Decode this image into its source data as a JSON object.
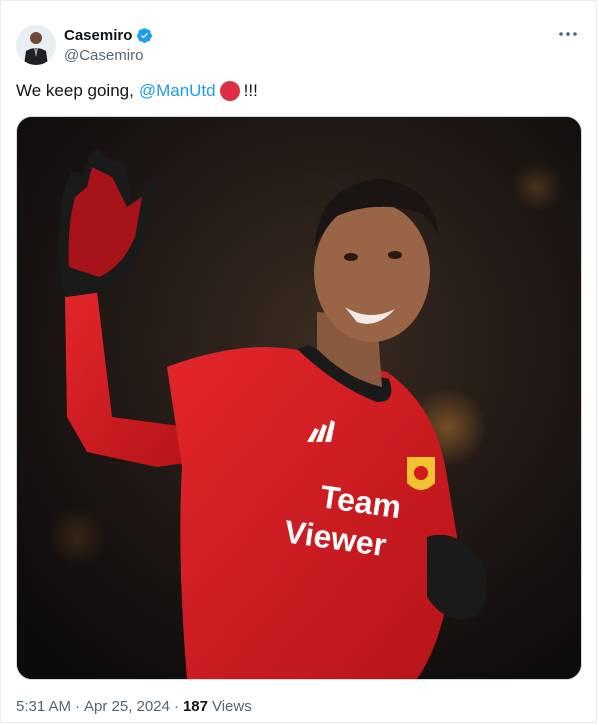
{
  "author": {
    "display_name": "Casemiro",
    "handle": "@Casemiro",
    "verified": true,
    "verified_icon": "verified-badge-icon",
    "verified_color": "#1d9bf0"
  },
  "tweet": {
    "text_before": "We keep going,",
    "mention": "@ManUtd",
    "emoji": "red-circle",
    "text_after": "!!!"
  },
  "media": {
    "jersey_sponsor": [
      "Team",
      "Viewer"
    ],
    "jersey_color": "#d3191f"
  },
  "meta": {
    "time": "5:31 AM",
    "separator": "·",
    "date": "Apr 25, 2024",
    "views_count": "187",
    "views_label": "Views"
  },
  "colors": {
    "link": "#1d9bf0",
    "text": "#0f1419",
    "secondary": "#536471"
  }
}
